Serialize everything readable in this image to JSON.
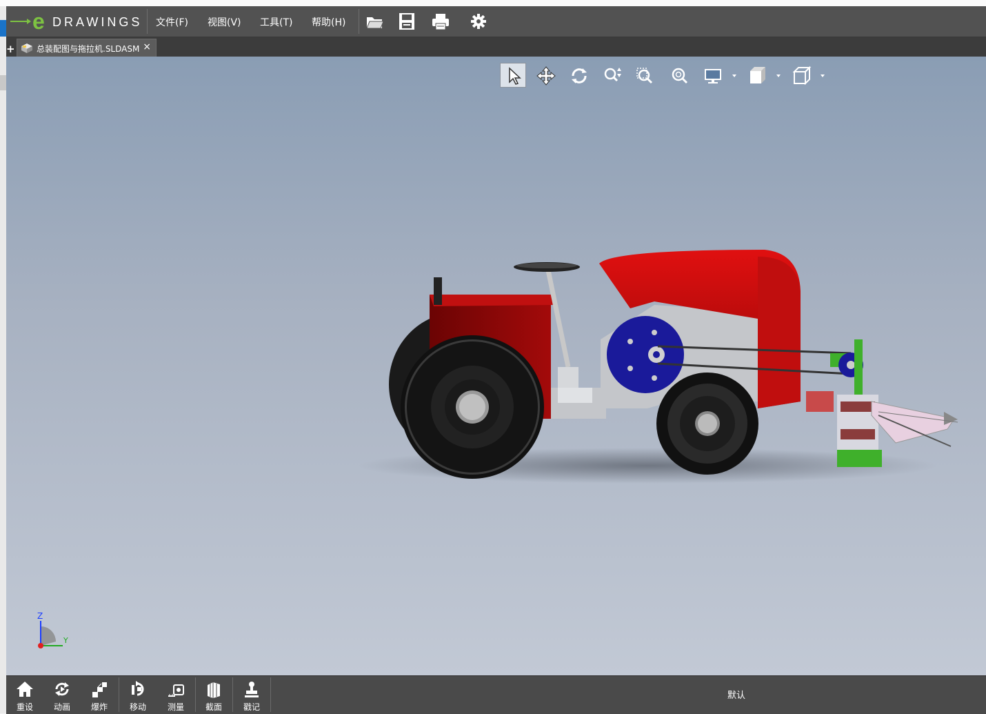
{
  "app": {
    "logo_text": "DRAWINGS",
    "menu": [
      {
        "label": "文件(F)"
      },
      {
        "label": "视图(V)"
      },
      {
        "label": "工具(T)"
      },
      {
        "label": "帮助(H)"
      }
    ],
    "toolbar_icons": [
      "open-icon",
      "save-icon",
      "print-icon",
      "settings-gear-icon"
    ]
  },
  "tabs": {
    "add_label": "+",
    "items": [
      {
        "label": "总装配图与拖拉机.SLDASM",
        "close": "×",
        "active": true
      }
    ]
  },
  "view_toolbar": {
    "tools": [
      "select-icon",
      "pan-icon",
      "rotate-icon",
      "zoom-icon",
      "zoom-to-area-icon",
      "zoom-to-fit-icon",
      "display-style-icon",
      "view-orientation-icon",
      "cube-view-icon"
    ]
  },
  "triad": {
    "z_label": "Z",
    "y_label": "Y"
  },
  "bottom_tools": [
    {
      "label": "重设",
      "icon": "home-icon"
    },
    {
      "label": "动画",
      "icon": "animate-icon"
    },
    {
      "label": "爆炸",
      "icon": "explode-icon"
    },
    {
      "label": "移动",
      "icon": "move-icon"
    },
    {
      "label": "测量",
      "icon": "measure-icon"
    },
    {
      "label": "截面",
      "icon": "section-icon"
    },
    {
      "label": "戳记",
      "icon": "stamp-icon"
    }
  ],
  "configuration": {
    "label": "默认"
  },
  "colors": {
    "body_red": "#b80c0c",
    "chassis_grey": "#c4c6ca",
    "pulley_blue": "#1a1a9a",
    "accent_green": "#3fb02b"
  }
}
